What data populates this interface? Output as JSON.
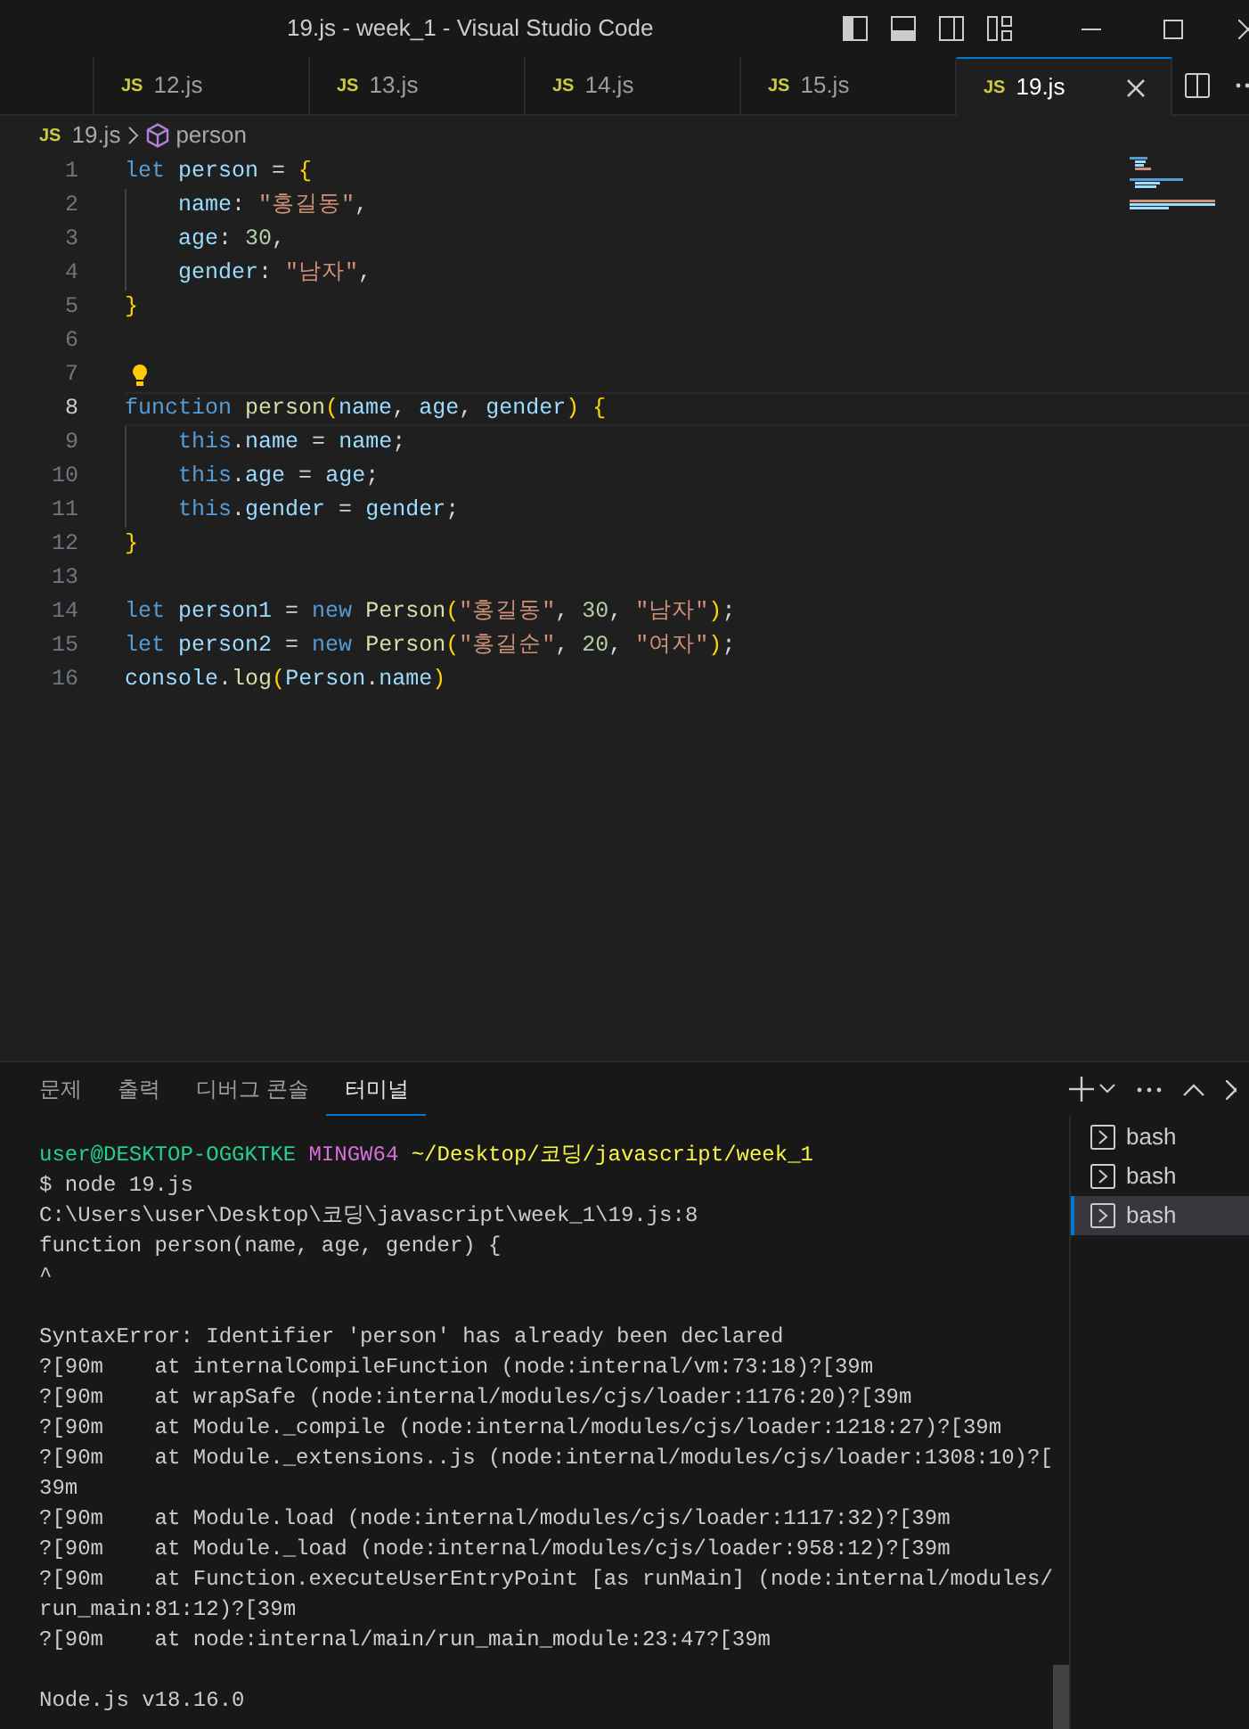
{
  "window": {
    "title": "19.js - week_1 - Visual Studio Code"
  },
  "tabs": [
    {
      "badge": "JS",
      "label": "12.js",
      "selected": false
    },
    {
      "badge": "JS",
      "label": "13.js",
      "selected": false
    },
    {
      "badge": "JS",
      "label": "14.js",
      "selected": false
    },
    {
      "badge": "JS",
      "label": "15.js",
      "selected": false
    },
    {
      "badge": "JS",
      "label": "19.js",
      "selected": true
    }
  ],
  "breadcrumb": [
    {
      "kind": "file",
      "badge": "JS",
      "label": "19.js"
    },
    {
      "kind": "symbol",
      "label": "person"
    }
  ],
  "editor": {
    "lines": [
      {
        "number": "1",
        "current": false,
        "lightbulb": false,
        "tokens": [
          {
            "kind": "kw",
            "text": "let "
          },
          {
            "kind": "var",
            "text": "person"
          },
          {
            "kind": "p",
            "text": " = "
          },
          {
            "kind": "b1",
            "text": "{"
          }
        ]
      },
      {
        "number": "2",
        "current": false,
        "lightbulb": false,
        "tokens": [
          {
            "kind": "indent"
          },
          {
            "kind": "var",
            "text": "name"
          },
          {
            "kind": "p",
            "text": ": "
          },
          {
            "kind": "str",
            "text": "\"홍길동\""
          },
          {
            "kind": "p",
            "text": ","
          }
        ]
      },
      {
        "number": "3",
        "current": false,
        "lightbulb": false,
        "tokens": [
          {
            "kind": "indent"
          },
          {
            "kind": "var",
            "text": "age"
          },
          {
            "kind": "p",
            "text": ": "
          },
          {
            "kind": "num",
            "text": "30"
          },
          {
            "kind": "p",
            "text": ","
          }
        ]
      },
      {
        "number": "4",
        "current": false,
        "lightbulb": false,
        "tokens": [
          {
            "kind": "indent"
          },
          {
            "kind": "var",
            "text": "gender"
          },
          {
            "kind": "p",
            "text": ": "
          },
          {
            "kind": "str",
            "text": "\"남자\""
          },
          {
            "kind": "p",
            "text": ","
          }
        ]
      },
      {
        "number": "5",
        "current": false,
        "lightbulb": false,
        "tokens": [
          {
            "kind": "b1",
            "text": "}"
          }
        ]
      },
      {
        "number": "6",
        "current": false,
        "lightbulb": false
      },
      {
        "number": "7",
        "current": false,
        "lightbulb": true
      },
      {
        "number": "8",
        "current": true,
        "lightbulb": false,
        "tokens": [
          {
            "kind": "kw",
            "text": "function "
          },
          {
            "kind": "fn",
            "text": "person"
          },
          {
            "kind": "b1",
            "text": "("
          },
          {
            "kind": "var",
            "text": "name"
          },
          {
            "kind": "p",
            "text": ", "
          },
          {
            "kind": "var",
            "text": "age"
          },
          {
            "kind": "p",
            "text": ", "
          },
          {
            "kind": "var",
            "text": "gender"
          },
          {
            "kind": "b1",
            "text": ")"
          },
          {
            "kind": "b1",
            "text": " {"
          }
        ]
      },
      {
        "number": "9",
        "current": false,
        "lightbulb": false,
        "tokens": [
          {
            "kind": "indent"
          },
          {
            "kind": "kw",
            "text": "this"
          },
          {
            "kind": "p",
            "text": "."
          },
          {
            "kind": "var",
            "text": "name"
          },
          {
            "kind": "p",
            "text": " = "
          },
          {
            "kind": "var",
            "text": "name"
          },
          {
            "kind": "p",
            "text": ";"
          }
        ]
      },
      {
        "number": "10",
        "current": false,
        "lightbulb": false,
        "tokens": [
          {
            "kind": "indent"
          },
          {
            "kind": "kw",
            "text": "this"
          },
          {
            "kind": "p",
            "text": "."
          },
          {
            "kind": "var",
            "text": "age"
          },
          {
            "kind": "p",
            "text": " = "
          },
          {
            "kind": "var",
            "text": "age"
          },
          {
            "kind": "p",
            "text": ";"
          }
        ]
      },
      {
        "number": "11",
        "current": false,
        "lightbulb": false,
        "tokens": [
          {
            "kind": "indent"
          },
          {
            "kind": "kw",
            "text": "this"
          },
          {
            "kind": "p",
            "text": "."
          },
          {
            "kind": "var",
            "text": "gender"
          },
          {
            "kind": "p",
            "text": " = "
          },
          {
            "kind": "var",
            "text": "gender"
          },
          {
            "kind": "p",
            "text": ";"
          }
        ]
      },
      {
        "number": "12",
        "current": false,
        "lightbulb": false,
        "tokens": [
          {
            "kind": "b1",
            "text": "}"
          }
        ]
      },
      {
        "number": "13",
        "current": false,
        "lightbulb": false
      },
      {
        "number": "14",
        "current": false,
        "lightbulb": false,
        "tokens": [
          {
            "kind": "kw",
            "text": "let "
          },
          {
            "kind": "var",
            "text": "person1"
          },
          {
            "kind": "p",
            "text": " = "
          },
          {
            "kind": "kw",
            "text": "new "
          },
          {
            "kind": "fn",
            "text": "Person"
          },
          {
            "kind": "b1",
            "text": "("
          },
          {
            "kind": "str",
            "text": "\"홍길동\""
          },
          {
            "kind": "p",
            "text": ", "
          },
          {
            "kind": "num",
            "text": "30"
          },
          {
            "kind": "p",
            "text": ", "
          },
          {
            "kind": "str",
            "text": "\"남자\""
          },
          {
            "kind": "b1",
            "text": ")"
          },
          {
            "kind": "p",
            "text": ";"
          }
        ]
      },
      {
        "number": "15",
        "current": false,
        "lightbulb": false,
        "tokens": [
          {
            "kind": "kw",
            "text": "let "
          },
          {
            "kind": "var",
            "text": "person2"
          },
          {
            "kind": "p",
            "text": " = "
          },
          {
            "kind": "kw",
            "text": "new "
          },
          {
            "kind": "fn",
            "text": "Person"
          },
          {
            "kind": "b1",
            "text": "("
          },
          {
            "kind": "str",
            "text": "\"홍길순\""
          },
          {
            "kind": "p",
            "text": ", "
          },
          {
            "kind": "num",
            "text": "20"
          },
          {
            "kind": "p",
            "text": ", "
          },
          {
            "kind": "str",
            "text": "\"여자\""
          },
          {
            "kind": "b1",
            "text": ")"
          },
          {
            "kind": "p",
            "text": ";"
          }
        ]
      },
      {
        "number": "16",
        "current": false,
        "lightbulb": false,
        "tokens": [
          {
            "kind": "var",
            "text": "console"
          },
          {
            "kind": "p",
            "text": "."
          },
          {
            "kind": "fn",
            "text": "log"
          },
          {
            "kind": "b1",
            "text": "("
          },
          {
            "kind": "var",
            "text": "Person"
          },
          {
            "kind": "p",
            "text": "."
          },
          {
            "kind": "var",
            "text": "name"
          },
          {
            "kind": "b1",
            "text": ")"
          }
        ]
      }
    ]
  },
  "panel": {
    "tabs": [
      {
        "label": "문제",
        "selected": false
      },
      {
        "label": "출력",
        "selected": false
      },
      {
        "label": "디버그 콘솔",
        "selected": false
      },
      {
        "label": "터미널",
        "selected": true
      }
    ],
    "terminal": [
      {
        "kind": "prompt",
        "segments": [
          {
            "kind": "user",
            "text": "user@DESKTOP-OGGKTKE "
          },
          {
            "kind": "host",
            "text": "MINGW64 "
          },
          {
            "kind": "path",
            "text": "~/Desktop/코딩/javascript/week_1"
          }
        ]
      },
      {
        "kind": "output",
        "text": "$ node 19.js"
      },
      {
        "kind": "output",
        "text": "C:\\Users\\user\\Desktop\\코딩\\javascript\\week_1\\19.js:8"
      },
      {
        "kind": "output",
        "text": "function person(name, age, gender) {"
      },
      {
        "kind": "output",
        "text": "^"
      },
      {
        "kind": "blank"
      },
      {
        "kind": "output",
        "text": "SyntaxError: Identifier 'person' has already been declared"
      },
      {
        "kind": "output",
        "text": "?[90m    at internalCompileFunction (node:internal/vm:73:18)?[39m"
      },
      {
        "kind": "output",
        "text": "?[90m    at wrapSafe (node:internal/modules/cjs/loader:1176:20)?[39m"
      },
      {
        "kind": "output",
        "text": "?[90m    at Module._compile (node:internal/modules/cjs/loader:1218:27)?[39m"
      },
      {
        "kind": "output",
        "text": "?[90m    at Module._extensions..js (node:internal/modules/cjs/loader:1308:10)?["
      },
      {
        "kind": "output",
        "text": "39m"
      },
      {
        "kind": "output",
        "text": "?[90m    at Module.load (node:internal/modules/cjs/loader:1117:32)?[39m"
      },
      {
        "kind": "output",
        "text": "?[90m    at Module._load (node:internal/modules/cjs/loader:958:12)?[39m"
      },
      {
        "kind": "output",
        "text": "?[90m    at Function.executeUserEntryPoint [as runMain] (node:internal/modules/"
      },
      {
        "kind": "output",
        "text": "run_main:81:12)?[39m"
      },
      {
        "kind": "output",
        "text": "?[90m    at node:internal/main/run_main_module:23:47?[39m"
      },
      {
        "kind": "blank"
      },
      {
        "kind": "output",
        "text": "Node.js v18.16.0"
      }
    ],
    "shells": [
      {
        "label": "bash",
        "selected": false
      },
      {
        "label": "bash",
        "selected": false
      },
      {
        "label": "bash",
        "selected": true
      }
    ]
  }
}
